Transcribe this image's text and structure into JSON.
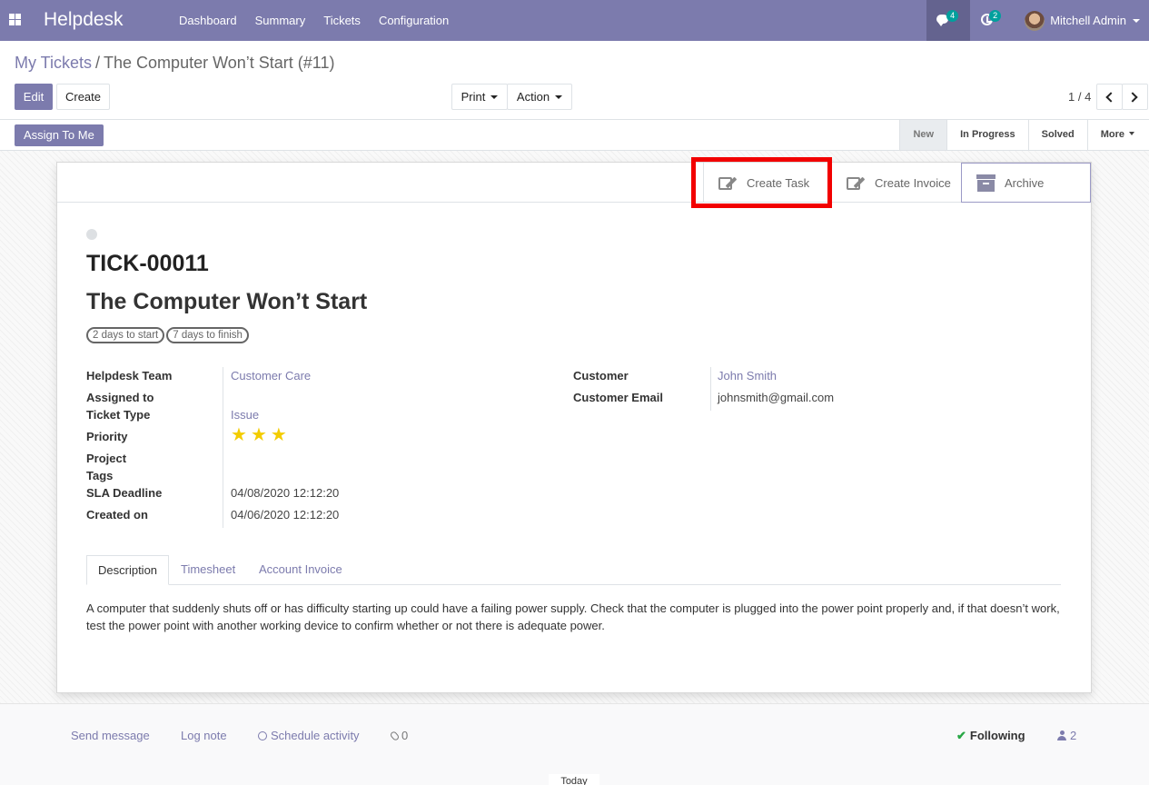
{
  "navbar": {
    "app_name": "Helpdesk",
    "menu": [
      "Dashboard",
      "Summary",
      "Tickets",
      "Configuration"
    ],
    "messages_count": "4",
    "activities_count": "2",
    "user_name": "Mitchell Admin",
    "color": "#7c7bad"
  },
  "breadcrumb": {
    "parent": "My Tickets",
    "separator": "/",
    "current": "The Computer Won’t Start (#11)"
  },
  "toolbar": {
    "edit": "Edit",
    "create": "Create",
    "print": "Print",
    "action": "Action",
    "pager": "1 / 4"
  },
  "statusbar": {
    "assign": "Assign To Me",
    "stages": [
      "New",
      "In Progress",
      "Solved"
    ],
    "active_stage": "New",
    "more": "More"
  },
  "smart_buttons": {
    "create_task": "Create Task",
    "create_invoice": "Create Invoice",
    "archive": "Archive"
  },
  "ticket": {
    "reference": "TICK-00011",
    "title": "The Computer Won’t Start",
    "sla_tags": [
      "2 days to start",
      "7 days to finish"
    ],
    "fields_left": {
      "team_label": "Helpdesk Team",
      "team_value": "Customer Care",
      "assigned_label": "Assigned to",
      "type_label": "Ticket Type",
      "type_value": "Issue",
      "priority_label": "Priority",
      "priority_stars": 3,
      "project_label": "Project",
      "tags_label": "Tags",
      "sla_label": "SLA Deadline",
      "sla_value": "04/08/2020 12:12:20",
      "created_label": "Created on",
      "created_value": "04/06/2020 12:12:20"
    },
    "fields_right": {
      "customer_label": "Customer",
      "customer_value": "John Smith",
      "email_label": "Customer Email",
      "email_value": "johnsmith@gmail.com"
    }
  },
  "tabs": [
    "Description",
    "Timesheet",
    "Account Invoice"
  ],
  "description": "A computer that suddenly shuts off or has difficulty starting up could have a failing power supply. Check that the computer is plugged into the power point properly and, if that doesn’t work, test the power point with another working device to confirm whether or not there is adequate power.",
  "chatter": {
    "send_message": "Send message",
    "log_note": "Log note",
    "schedule_activity": "Schedule activity",
    "attachments": "0",
    "following": "Following",
    "followers": "2",
    "today": "Today"
  }
}
